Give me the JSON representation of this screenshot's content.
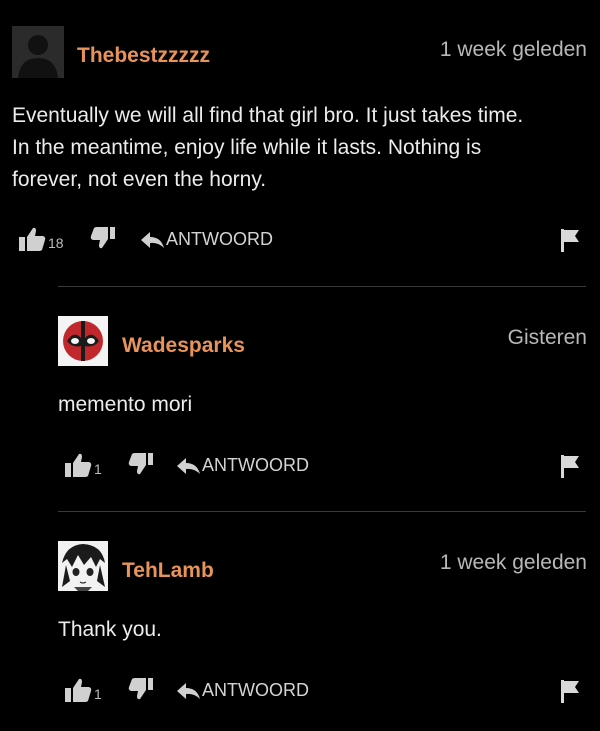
{
  "colors": {
    "background": "#000000",
    "username": "#e8935a",
    "text": "#ececec",
    "muted": "#b8b8b8",
    "divider": "#3a3a3a"
  },
  "comments": [
    {
      "username": "Thebestzzzzz",
      "timestamp": "1 week geleden",
      "lines": [
        "Eventually we will all find that girl bro. It just takes time.",
        "In the meantime, enjoy life while it lasts. Nothing is",
        "forever, not even the horny."
      ],
      "likes": "18",
      "reply_label": "ANTWOORD",
      "avatar_icon": "default-user-avatar-icon"
    },
    {
      "username": "Wadesparks",
      "timestamp": "Gisteren",
      "lines": [
        "memento mori"
      ],
      "likes": "1",
      "reply_label": "ANTWOORD",
      "avatar_icon": "deadpool-mask-avatar-icon"
    },
    {
      "username": "TehLamb",
      "timestamp": "1 week geleden",
      "lines": [
        "Thank you."
      ],
      "likes": "1",
      "reply_label": "ANTWOORD",
      "avatar_icon": "anime-sketch-avatar-icon"
    }
  ]
}
